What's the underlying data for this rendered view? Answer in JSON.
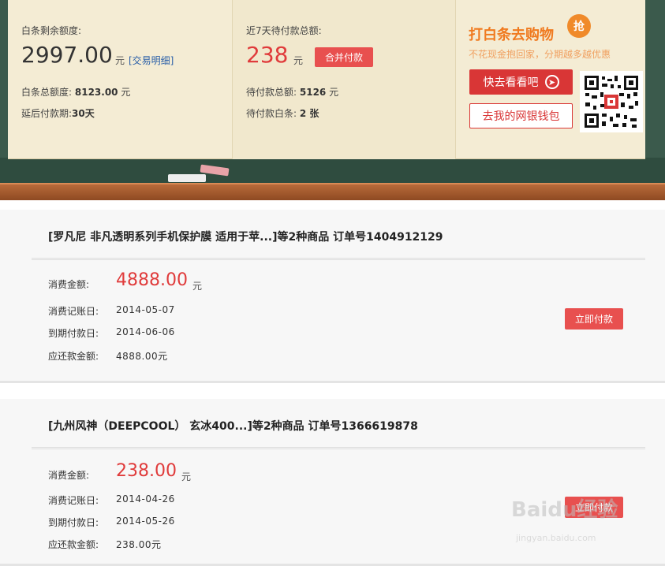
{
  "summary": {
    "remaining_label": "白条剩余额度:",
    "remaining_value": "2997.00",
    "remaining_unit": "元",
    "transactions_link": "[交易明细]",
    "total_label": "白条总额度:",
    "total_value": "8123.00",
    "total_unit": "元",
    "deferral_label": "延后付款期:",
    "deferral_value": "30天",
    "week_due_label": "近7天待付款总额:",
    "week_due_value": "238",
    "week_due_unit": "元",
    "merge_button": "合并付款",
    "pending_total_label": "待付款总额:",
    "pending_total_value": "5126",
    "pending_total_unit": "元",
    "pending_count_label": "待付款白条:",
    "pending_count_value": "2 张"
  },
  "promo": {
    "title": "打白条去购物",
    "badge": "抢",
    "subtitle": "不花现金抱回家，分期越多越优惠",
    "look_button": "快去看看吧",
    "wallet_button": "去我的网银钱包"
  },
  "orders": [
    {
      "title": "[罗凡尼 非凡透明系列手机保护膜 适用于苹...]等2种商品 订单号1404912129",
      "amount_label": "消费金额:",
      "amount": "4888.00",
      "amount_unit": "元",
      "record_date_label": "消费记账日:",
      "record_date": "2014-05-07",
      "due_date_label": "到期付款日:",
      "due_date": "2014-06-06",
      "repay_label": "应还款金额:",
      "repay": "4888.00元",
      "pay_button": "立即付款"
    },
    {
      "title": "[九州风神（DEEPCOOL） 玄冰400...]等2种商品 订单号1366619878",
      "amount_label": "消费金额:",
      "amount": "238.00",
      "amount_unit": "元",
      "record_date_label": "消费记账日:",
      "record_date": "2014-04-26",
      "due_date_label": "到期付款日:",
      "due_date": "2014-05-26",
      "repay_label": "应还款金额:",
      "repay": "238.00元",
      "pay_button": "立即付款"
    }
  ],
  "watermark": {
    "brand": "Baidu经验",
    "url": "jingyan.baidu.com"
  },
  "colors": {
    "accent_red": "#e8504f",
    "amount_red": "#e03b3b",
    "promo_orange": "#f07a1f",
    "board_green": "#3b5a4c",
    "paper": "#f4ecd4"
  },
  "icons": {
    "arrow": "arrow-right-circle-icon",
    "qr": "qr-code-icon"
  }
}
